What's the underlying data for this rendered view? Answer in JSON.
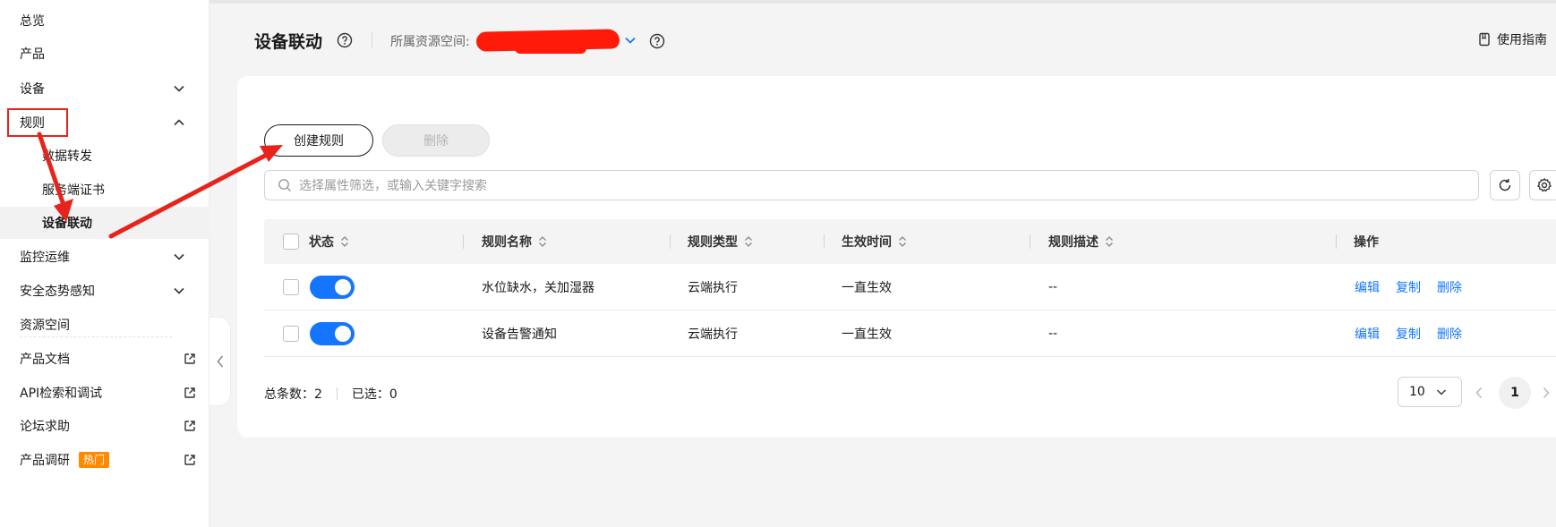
{
  "sidebar": {
    "items": [
      {
        "label": "总览"
      },
      {
        "label": "产品"
      },
      {
        "label": "设备"
      },
      {
        "label": "规则"
      },
      {
        "label": "数据转发"
      },
      {
        "label": "服务端证书"
      },
      {
        "label": "设备联动"
      },
      {
        "label": "监控运维"
      },
      {
        "label": "安全态势感知"
      },
      {
        "label": "资源空间"
      },
      {
        "label": "产品文档"
      },
      {
        "label": "API检索和调试"
      },
      {
        "label": "论坛求助"
      },
      {
        "label": "产品调研"
      }
    ],
    "hot_badge": "热门",
    "active_item": "设备联动"
  },
  "header": {
    "title": "设备联动",
    "resource_space_label": "所属资源空间:",
    "guide_label": "使用指南"
  },
  "toolbar": {
    "create_label": "创建规则",
    "delete_label": "删除",
    "search_placeholder": "选择属性筛选，或输入关键字搜索"
  },
  "table": {
    "columns": [
      "状态",
      "规则名称",
      "规则类型",
      "生效时间",
      "规则描述",
      "操作"
    ],
    "rows": [
      {
        "enabled": true,
        "name": "水位缺水，关加湿器",
        "type": "云端执行",
        "effective": "一直生效",
        "desc": "--",
        "ops": [
          "编辑",
          "复制",
          "删除"
        ]
      },
      {
        "enabled": true,
        "name": "设备告警通知",
        "type": "云端执行",
        "effective": "一直生效",
        "desc": "--",
        "ops": [
          "编辑",
          "复制",
          "删除"
        ]
      }
    ]
  },
  "footer": {
    "total_label": "总条数：2",
    "selected_label": "已选：0",
    "page_size": "10",
    "current_page": "1"
  },
  "colors": {
    "accent": "#1476ff",
    "annotation": "#e8231b",
    "hot": "#ff8a00"
  }
}
